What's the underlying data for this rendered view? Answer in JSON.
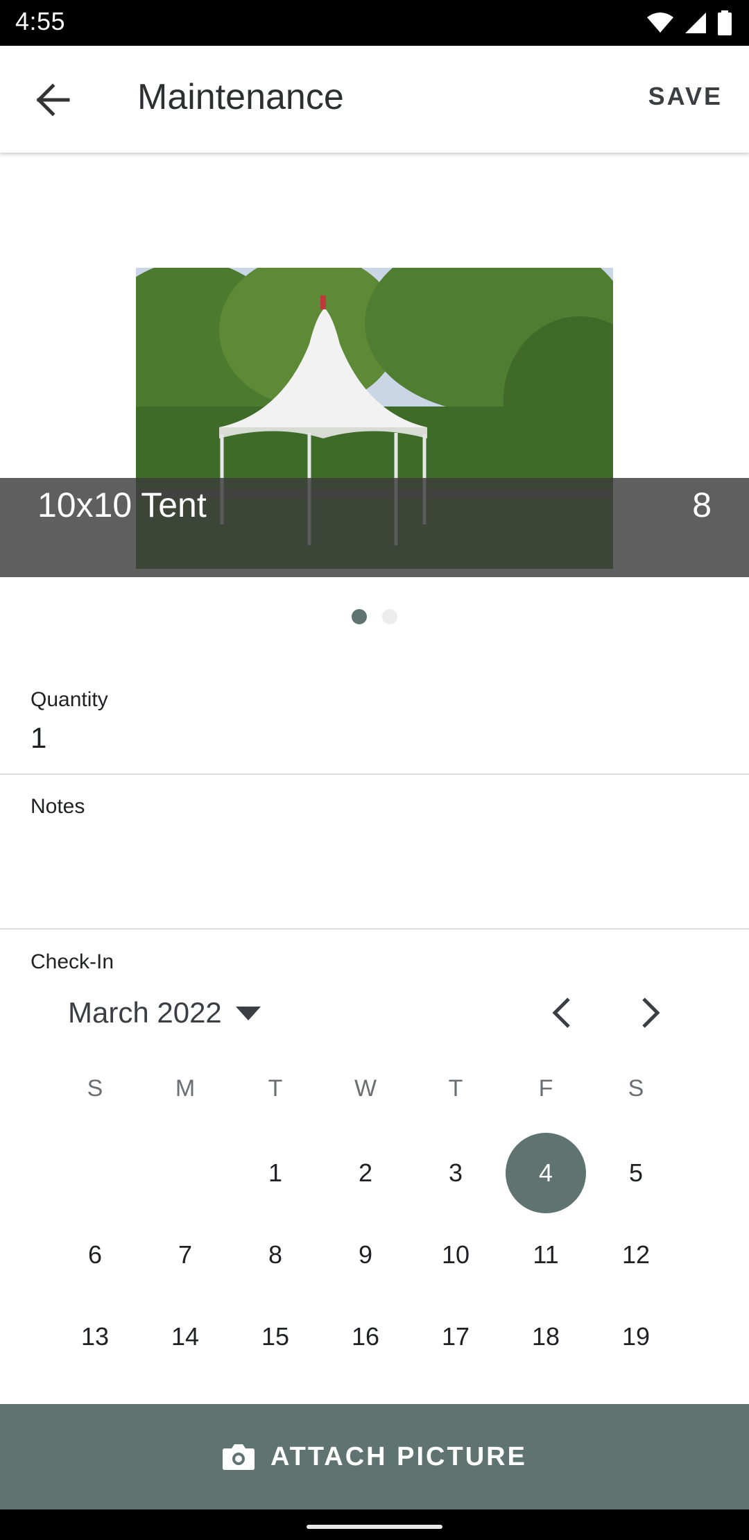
{
  "status_bar": {
    "time": "4:55",
    "icons": [
      "wifi-icon",
      "signal-icon",
      "battery-icon"
    ]
  },
  "app_bar": {
    "back_icon": "arrow-left-icon",
    "title": "Maintenance",
    "save_label": "SAVE"
  },
  "carousel": {
    "item_name": "10x10 Tent",
    "item_count": "8",
    "page_count": 2,
    "active_page": 1
  },
  "quantity": {
    "label": "Quantity",
    "value": "1"
  },
  "notes": {
    "label": "Notes",
    "value": ""
  },
  "check_in": {
    "label": "Check-In",
    "month_label": "March 2022",
    "weekdays": [
      "S",
      "M",
      "T",
      "W",
      "T",
      "F",
      "S"
    ],
    "leading_blanks": 2,
    "visible_days": [
      "1",
      "2",
      "3",
      "4",
      "5",
      "6",
      "7",
      "8",
      "9",
      "10",
      "11",
      "12",
      "13",
      "14",
      "15",
      "16",
      "17",
      "18",
      "19"
    ],
    "selected_day": "4"
  },
  "attach_button": {
    "icon": "camera-icon",
    "label": "ATTACH PICTURE"
  },
  "colors": {
    "accent": "#5f7471",
    "caption_overlay": "#3c3c3c"
  }
}
